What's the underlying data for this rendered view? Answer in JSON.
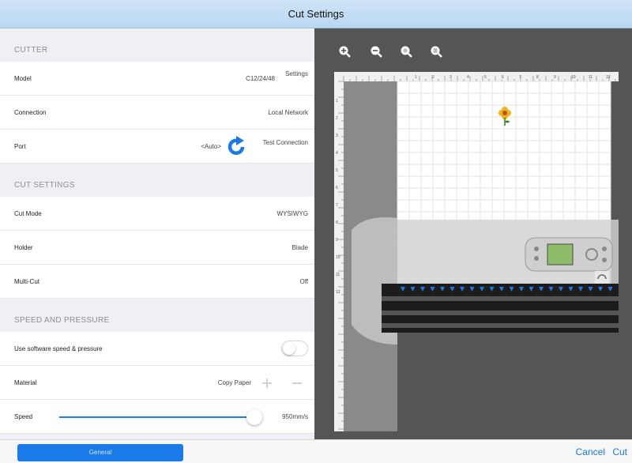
{
  "window": {
    "title": "Cut Settings"
  },
  "cutter": {
    "header": "CUTTER",
    "model_label": "Model",
    "model_value": "C12/24/48",
    "settings_link": "Settings",
    "connection_label": "Connection",
    "connection_value": "Local Network",
    "port_label": "Port",
    "port_value": "<Auto>",
    "test_connection": "Test Connection"
  },
  "cut_settings": {
    "header": "CUT SETTINGS",
    "mode_label": "Cut Mode",
    "mode_value": "WYSIWYG",
    "holder_label": "Holder",
    "holder_value": "Blade",
    "multicut_label": "Multi-Cut",
    "multicut_value": "Off"
  },
  "speed_pressure": {
    "header": "SPEED AND PRESSURE",
    "use_software_label": "Use software speed & pressure",
    "use_software_on": false,
    "material_label": "Material",
    "material_value": "Copy Paper",
    "speed_label": "Speed",
    "speed_value": "950mm/s",
    "speed_fraction": 0.97
  },
  "footer": {
    "general_button": "General",
    "cancel_button": "Cancel",
    "cut_button": "Cut"
  },
  "preview": {
    "ruler_numbers_top": [
      "1",
      "2",
      "3",
      "4",
      "5",
      "6",
      "7",
      "8",
      "9",
      "10",
      "11",
      "12"
    ],
    "ruler_numbers_left": [
      "1",
      "2",
      "3",
      "4",
      "5",
      "6",
      "7",
      "8",
      "9",
      "10",
      "11",
      "12"
    ],
    "accent": "#1a7ae8"
  }
}
